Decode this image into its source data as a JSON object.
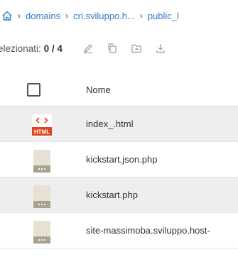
{
  "breadcrumb": {
    "separator": "›",
    "items": [
      "domains",
      "cri.sviluppo.h...",
      "public_l"
    ]
  },
  "toolbar": {
    "selected_label": "elezionati:",
    "selected_count": "0 / 4"
  },
  "table": {
    "header": {
      "name": "Nome"
    },
    "rows": [
      {
        "name": "index_.html",
        "icon": "html-file-icon",
        "icon_label": "HTML"
      },
      {
        "name": "kickstart.json.php",
        "icon": "generic-file-icon",
        "icon_label": "..."
      },
      {
        "name": "kickstart.php",
        "icon": "generic-file-icon",
        "icon_label": "..."
      },
      {
        "name": "site-massimoba.sviluppo.host-",
        "icon": "generic-file-icon",
        "icon_label": "..."
      }
    ]
  },
  "colors": {
    "link": "#2f7dc9",
    "row_alt": "#eeeeee",
    "html_icon_red": "#e0451f",
    "file_icon_beige": "#e6e1d3",
    "file_icon_band": "#a9a28f"
  }
}
